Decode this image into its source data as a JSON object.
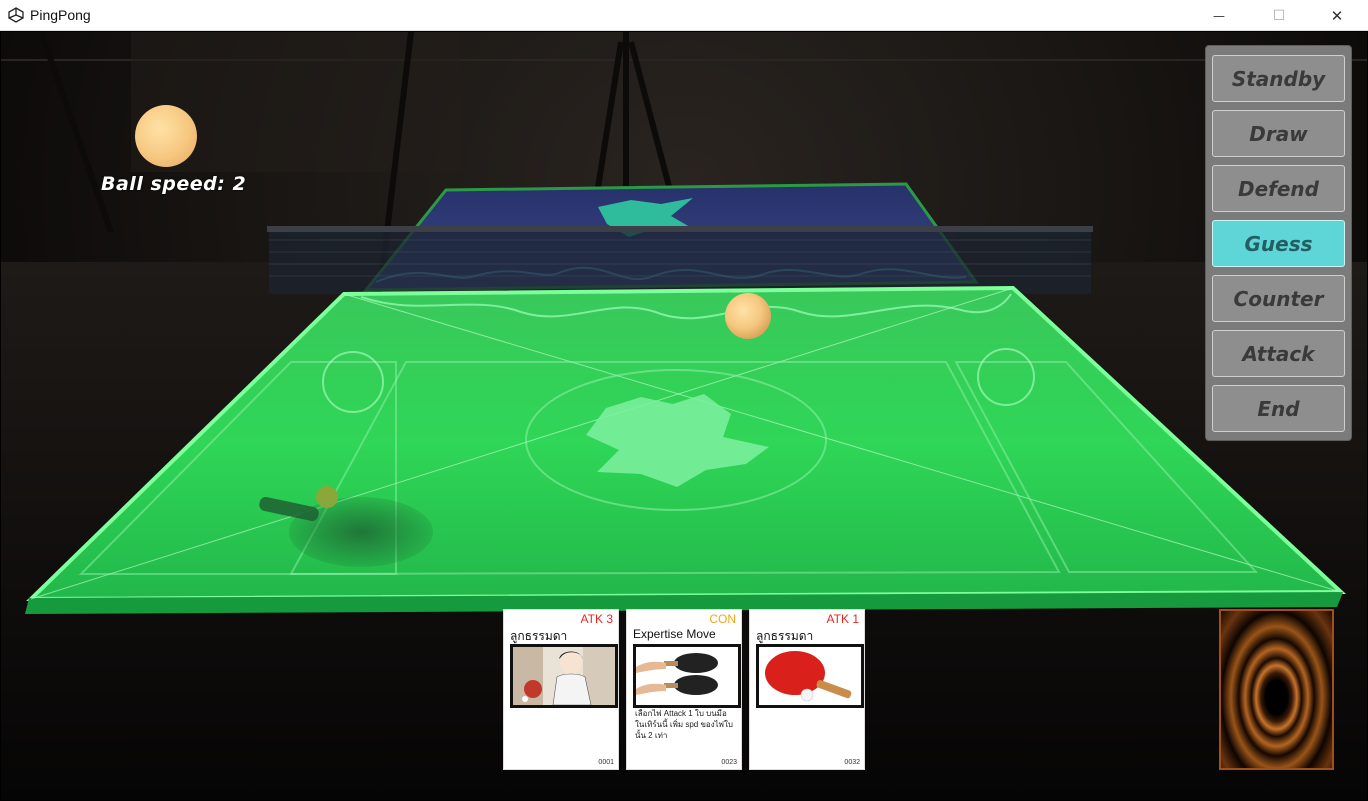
{
  "window": {
    "title": "PingPong",
    "minimize_glyph": "—",
    "maximize_glyph": "☐",
    "close_glyph": "✕"
  },
  "hud": {
    "ball_speed_label": "Ball speed: 2"
  },
  "phases": [
    {
      "label": "Standby",
      "active": false
    },
    {
      "label": "Draw",
      "active": false
    },
    {
      "label": "Defend",
      "active": false
    },
    {
      "label": "Guess",
      "active": true
    },
    {
      "label": "Counter",
      "active": false
    },
    {
      "label": "Attack",
      "active": false
    },
    {
      "label": "End",
      "active": false
    }
  ],
  "hand": [
    {
      "type": "ATK 3",
      "type_color": "#e8261f",
      "name": "ลูกธรรมดา",
      "description": "",
      "number": "0001",
      "art": "player-serving-art"
    },
    {
      "type": "CON",
      "type_color": "#f2a51a",
      "name": "Expertise Move",
      "description": "เลือกไพ่ Attack 1 ใบ บนมือในเทิร์นนี้ เพิ่ม spd ของไพ่ใบนั้น 2 เท่า",
      "number": "0023",
      "art": "two-paddles-art"
    },
    {
      "type": "ATK 1",
      "type_color": "#e8261f",
      "name": "ลูกธรรมดา",
      "description": "",
      "number": "0032",
      "art": "red-paddle-art"
    }
  ],
  "colors": {
    "table_green": "#2fe05a",
    "active_button": "#5ed6d8",
    "ball": "#f6c77f"
  }
}
